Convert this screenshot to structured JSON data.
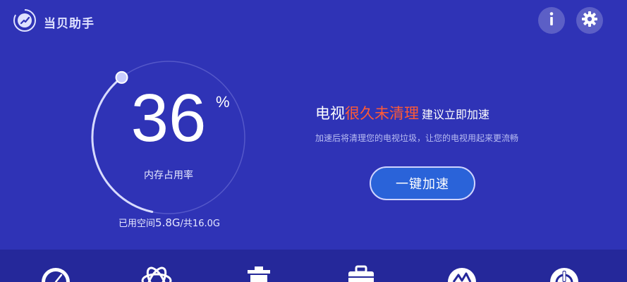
{
  "app": {
    "title": "当贝助手",
    "logo_icon": "rocket-gauge-icon"
  },
  "header": {
    "info_icon": "info-icon",
    "settings_icon": "gear-icon"
  },
  "gauge": {
    "percent": "36",
    "unit": "%",
    "label": "内存占用率",
    "fraction": 0.36
  },
  "memory": {
    "prefix": "已用空间",
    "used": "5.8G",
    "separator": "/共",
    "total": "16.0G"
  },
  "message": {
    "part1": "电视",
    "part2": "很久未清理",
    "part3": "建议立即加速",
    "subtitle": "加速后将清理您的电视垃圾，让您的电视用起来更流畅"
  },
  "action": {
    "boost_label": "一键加速"
  },
  "bottom_tools": [
    {
      "icon": "speedometer-icon"
    },
    {
      "icon": "atom-icon"
    },
    {
      "icon": "trash-icon"
    },
    {
      "icon": "toolbox-icon"
    },
    {
      "icon": "network-speed-icon"
    },
    {
      "icon": "power-icon"
    }
  ],
  "colors": {
    "background": "#2f33b6",
    "alert": "#ff5a36",
    "button": "#2a63d9",
    "bottom_bar": "#25289a"
  }
}
